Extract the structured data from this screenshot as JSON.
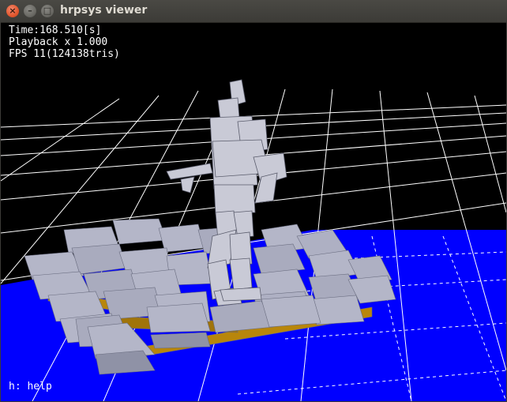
{
  "window": {
    "title": "hrpsys viewer",
    "close_glyph": "×",
    "minimize_glyph": "–",
    "maximize_glyph": "□"
  },
  "hud": {
    "time": "Time:168.510[s]",
    "playback": "Playback x 1.000",
    "fps": "FPS 11(124138tris)",
    "help": "h: help"
  },
  "colors": {
    "background": "#000000",
    "grid": "#ffffff",
    "floor": "#0000ff",
    "block_top": "#b4b6c8",
    "block_side": "#8f92a6",
    "block_base": "#b8860b",
    "robot": "#c9cad6"
  }
}
